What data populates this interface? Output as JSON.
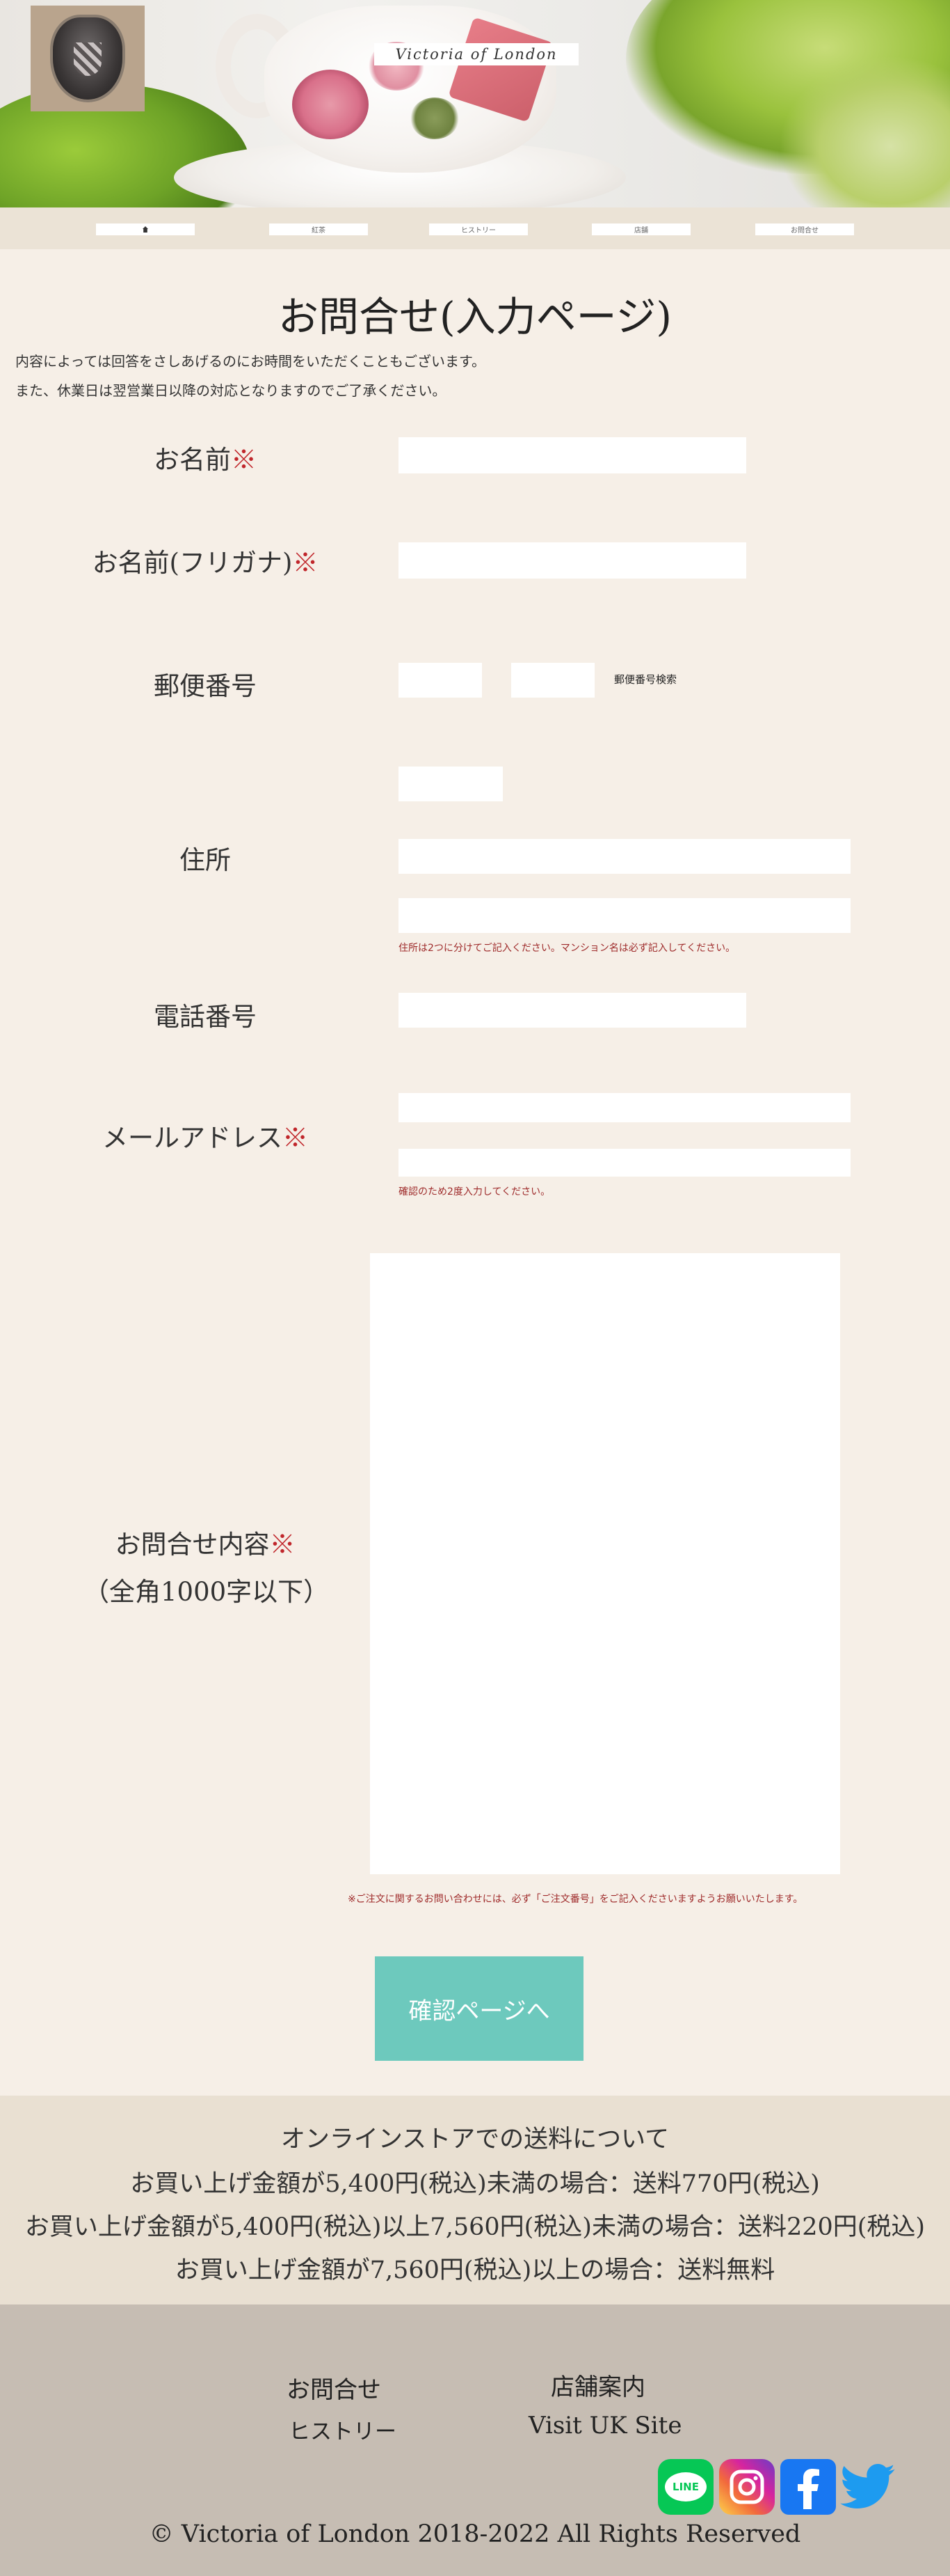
{
  "header": {
    "brand": "Victoria of London"
  },
  "nav": {
    "items": [
      "紅茶",
      "ヒストリー",
      "店舗",
      "お問合せ"
    ]
  },
  "main": {
    "title": "お問合せ(入力ページ)",
    "intro_1": "内容によっては回答をさしあげるのにお時間をいただくこともございます。",
    "intro_2": "また、休業日は翌営業日以降の対応となりますのでご了承ください。",
    "required_mark": "※",
    "fields": {
      "name_label": "お名前",
      "kana_label": "お名前(フリガナ)",
      "zip_label": "郵便番号",
      "zip_search": "郵便番号検索",
      "address_label": "住所",
      "address_note": "住所は2つに分けてご記入ください。マンション名は必ず記入してください。",
      "phone_label": "電話番号",
      "email_label": "メールアドレス",
      "email_note": "確認のため2度入力してください。",
      "message_label": "お問合せ内容",
      "message_sub": "（全角1000字以下）",
      "message_note": "※ご注文に関するお問い合わせには、必ず「ご注文番号」をご記入くださいますようお願いいたします。"
    },
    "submit_label": "確認ページへ"
  },
  "shipping": {
    "title": "オンラインストアでの送料について",
    "lines": [
      "お買い上げ金額が5,400円(税込)未満の場合：送料770円(税込)",
      "お買い上げ金額が5,400円(税込)以上7,560円(税込)未満の場合：送料220円(税込)",
      "お買い上げ金額が7,560円(税込)以上の場合：送料無料"
    ]
  },
  "footer": {
    "links": [
      "お問合せ",
      "店舗案内",
      "ヒストリー",
      "Visit UK Site"
    ],
    "social": {
      "line_text": "LINE",
      "line_color": "#06c755",
      "facebook_color": "#1877f2",
      "twitter_color": "#1d9bf0",
      "instagram_color": "#d6249f"
    },
    "copyright": "© Victoria of London 2018-2022 All Rights Reserved"
  }
}
